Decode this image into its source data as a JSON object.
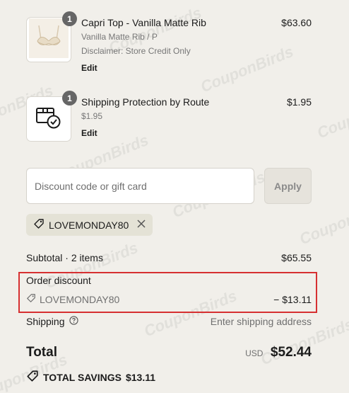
{
  "watermark": "CouponBirds",
  "items": [
    {
      "name": "Capri Top - Vanilla Matte Rib",
      "variant": "Vanilla Matte Rib / P",
      "note": "Disclaimer: Store Credit Only",
      "edit": "Edit",
      "price": "$63.60",
      "quantity": "1",
      "image_icon": "bra-image-icon"
    },
    {
      "name": "Shipping Protection by Route",
      "variant": "$1.95",
      "edit": "Edit",
      "price": "$1.95",
      "quantity": "1",
      "image_icon": "package-check-icon"
    }
  ],
  "discount": {
    "placeholder": "Discount code or gift card",
    "apply_label": "Apply",
    "applied_code": "LOVEMONDAY80"
  },
  "summary": {
    "subtotal_label": "Subtotal · 2 items",
    "subtotal_value": "$65.55",
    "order_discount_label": "Order discount",
    "discount_code": "LOVEMONDAY80",
    "discount_value": "− $13.11",
    "shipping_label": "Shipping",
    "shipping_value": "Enter shipping address",
    "total_label": "Total",
    "currency": "USD",
    "total_value": "$52.44",
    "savings_label": "TOTAL SAVINGS",
    "savings_value": "$13.11"
  },
  "colors": {
    "background": "#f1efea",
    "highlight_border": "#d63031"
  }
}
